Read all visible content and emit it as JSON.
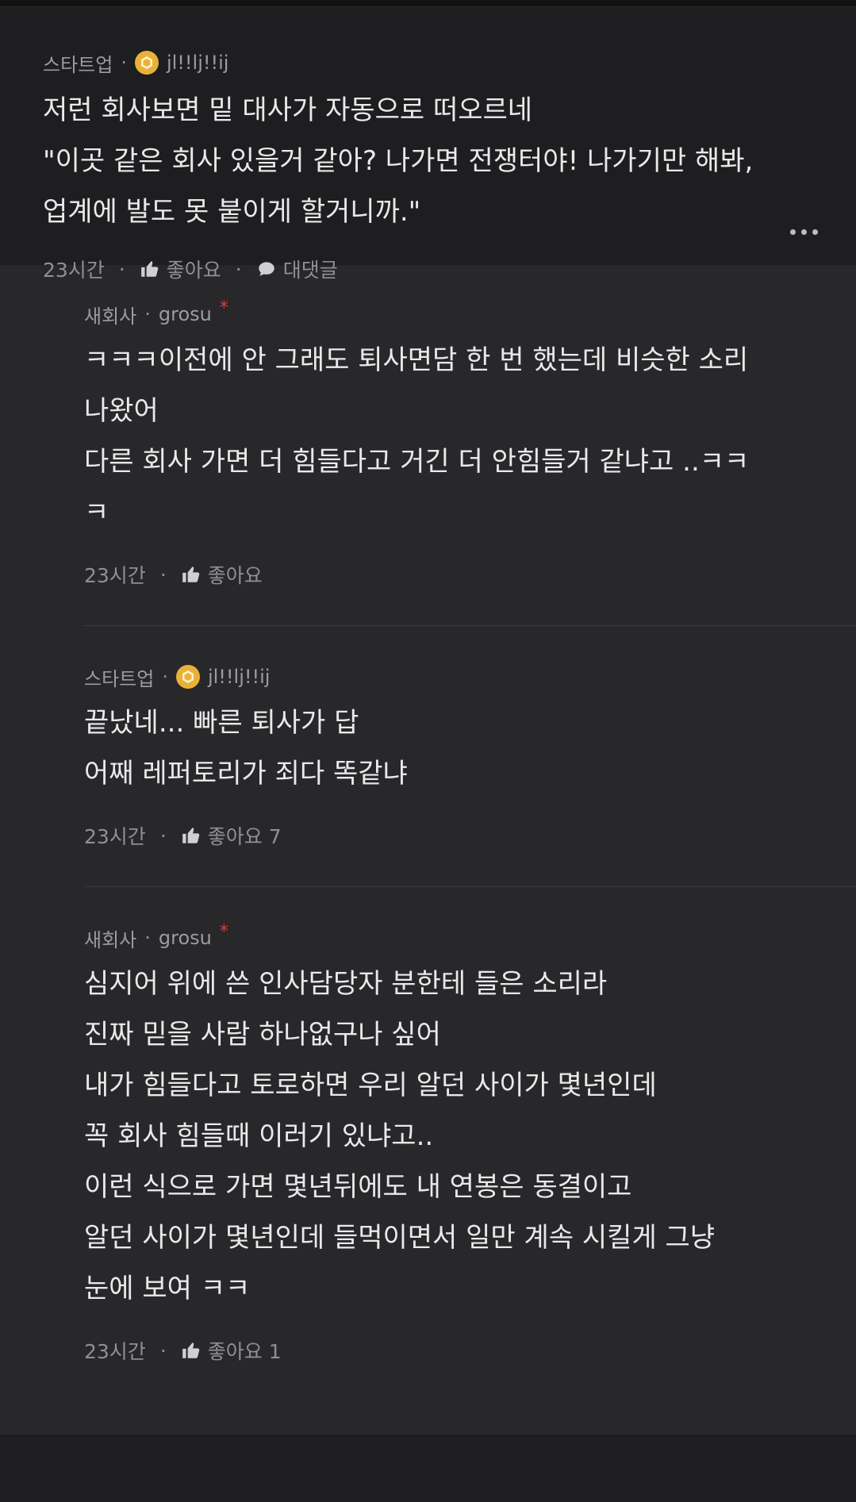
{
  "main": {
    "category": "스타트업",
    "username": "jl!!lj!!ij",
    "text": "저런 회사보면 밑 대사가 자동으로 떠오르네\n\"이곳 같은 회사 있을거 같아? 나가면 전쟁터야! 나가기만 해봐,\n업계에 발도 못 붙이게 할거니까.\"",
    "time": "23시간",
    "like_label": "좋아요",
    "reply_label": "대댓글"
  },
  "replies": [
    {
      "category": "새회사",
      "username": "grosu",
      "text": "ㅋㅋㅋ이전에 안 그래도 퇴사면담 한 번 했는데 비슷한 소리\n나왔어\n다른 회사 가면 더 힘들다고 거긴 더 안힘들거 같냐고 ..ㅋㅋ\nㅋ",
      "time": "23시간",
      "like_label": "좋아요"
    },
    {
      "category": "스타트업",
      "username": "jl!!lj!!ij",
      "text": "끝났네... 빠른 퇴사가 답\n어째 레퍼토리가 죄다 똑같냐",
      "time": "23시간",
      "like_label": "좋아요 7"
    },
    {
      "category": "새회사",
      "username": "grosu",
      "text": "심지어 위에 쓴 인사담당자 분한테 들은 소리라\n진짜 믿을 사람 하나없구나 싶어\n내가 힘들다고 토로하면 우리 알던 사이가 몇년인데\n꼭 회사 힘들때 이러기 있냐고..\n이런 식으로 가면 몇년뒤에도 내 연봉은 동결이고\n알던 사이가 몇년인데 들먹이면서 일만 계속 시킬게 그냥\n눈에 보여 ㅋㅋ",
      "time": "23시간",
      "like_label": "좋아요 1"
    }
  ],
  "icons": [
    "hexagon-badge-icon",
    "thumbs-up-icon",
    "chat-bubble-icon",
    "more-options-icon"
  ],
  "colors": {
    "background": "#1e1e20",
    "reply_background": "#28282b",
    "badge": "#e8b23a",
    "star": "#e33a3a"
  }
}
